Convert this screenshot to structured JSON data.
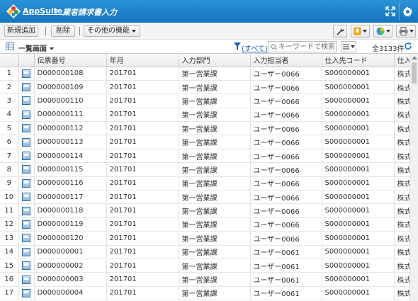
{
  "header": {
    "brand": "AppSuite",
    "separator": ">",
    "title": "業者請求書入力",
    "colors": {
      "bar": "#1f86cf"
    }
  },
  "toolbar": {
    "new_label": "新規追加",
    "delete_label": "削除",
    "other_label": "その他の機能",
    "icons": [
      "wrench-icon",
      "bookmark-icon",
      "chart-icon",
      "print-icon"
    ]
  },
  "subbar": {
    "view_label": "一覧画面",
    "filter_label": "(すべて)",
    "search_placeholder": "キーワードで検索",
    "count": "全3133件"
  },
  "table": {
    "columns": [
      "",
      "",
      "伝票番号",
      "年月",
      "入力部門",
      "入力担当者",
      "仕入先コード",
      "仕入"
    ],
    "rows": [
      {
        "n": "1",
        "no": "D000000108",
        "ym": "201701",
        "dept": "第一営業課",
        "user": "ユーザー0066",
        "code": "S000000001",
        "last": "株式"
      },
      {
        "n": "2",
        "no": "D000000109",
        "ym": "201701",
        "dept": "第一営業課",
        "user": "ユーザー0066",
        "code": "S000000001",
        "last": "株式"
      },
      {
        "n": "3",
        "no": "D000000110",
        "ym": "201701",
        "dept": "第一営業課",
        "user": "ユーザー0066",
        "code": "S000000001",
        "last": "株式"
      },
      {
        "n": "4",
        "no": "D000000111",
        "ym": "201701",
        "dept": "第一営業課",
        "user": "ユーザー0066",
        "code": "S000000001",
        "last": "株式"
      },
      {
        "n": "5",
        "no": "D000000112",
        "ym": "201701",
        "dept": "第一営業課",
        "user": "ユーザー0066",
        "code": "S000000001",
        "last": "株式"
      },
      {
        "n": "6",
        "no": "D000000113",
        "ym": "201701",
        "dept": "第一営業課",
        "user": "ユーザー0066",
        "code": "S000000001",
        "last": "株式"
      },
      {
        "n": "7",
        "no": "D000000114",
        "ym": "201701",
        "dept": "第一営業課",
        "user": "ユーザー0066",
        "code": "S000000001",
        "last": "株式"
      },
      {
        "n": "8",
        "no": "D000000115",
        "ym": "201701",
        "dept": "第一営業課",
        "user": "ユーザー0066",
        "code": "S000000001",
        "last": "株式"
      },
      {
        "n": "9",
        "no": "D000000116",
        "ym": "201701",
        "dept": "第一営業課",
        "user": "ユーザー0066",
        "code": "S000000001",
        "last": "株式"
      },
      {
        "n": "10",
        "no": "D000000117",
        "ym": "201701",
        "dept": "第一営業課",
        "user": "ユーザー0066",
        "code": "S000000001",
        "last": "株式"
      },
      {
        "n": "11",
        "no": "D000000118",
        "ym": "201701",
        "dept": "第一営業課",
        "user": "ユーザー0066",
        "code": "S000000001",
        "last": "株式"
      },
      {
        "n": "12",
        "no": "D000000119",
        "ym": "201701",
        "dept": "第一営業課",
        "user": "ユーザー0066",
        "code": "S000000001",
        "last": "株式"
      },
      {
        "n": "13",
        "no": "D000000120",
        "ym": "201701",
        "dept": "第一営業課",
        "user": "ユーザー0066",
        "code": "S000000001",
        "last": "株式"
      },
      {
        "n": "14",
        "no": "D000000001",
        "ym": "201701",
        "dept": "第一営業課",
        "user": "ユーザー0061",
        "code": "S000000001",
        "last": "株式"
      },
      {
        "n": "15",
        "no": "D000000002",
        "ym": "201701",
        "dept": "第一営業課",
        "user": "ユーザー0061",
        "code": "S000000001",
        "last": "株式"
      },
      {
        "n": "16",
        "no": "D000000003",
        "ym": "201701",
        "dept": "第一営業課",
        "user": "ユーザー0061",
        "code": "S000000001",
        "last": "株式"
      },
      {
        "n": "17",
        "no": "D000000004",
        "ym": "201701",
        "dept": "第一営業課",
        "user": "ユーザー0061",
        "code": "S000000001",
        "last": "株式"
      }
    ]
  }
}
